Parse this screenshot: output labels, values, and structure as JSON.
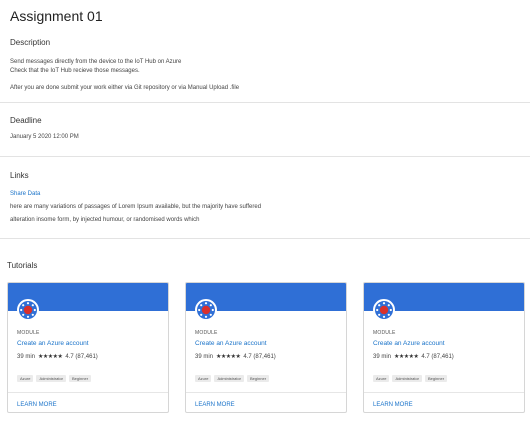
{
  "title": "Assignment 01",
  "description": {
    "heading": "Description",
    "lines": [
      "Send messages directly from the device to the IoT Hub on Azure",
      "Check that the IoT Hub recieve those messages.",
      "After you are done submit your work either via Git repository or via Manual Upload .file"
    ]
  },
  "deadline": {
    "heading": "Deadline",
    "value": "January 5 2020 12:00 PM"
  },
  "links": {
    "heading": "Links",
    "link_label": "Share Data",
    "lines": [
      "here are many variations of passages of Lorem Ipsum available, but the majority have suffered",
      "alteration insome form, by injected humour, or randomised words which"
    ]
  },
  "tutorials": {
    "heading": "Tutorials",
    "cards": [
      {
        "icon": "azure-module-icon",
        "type": "MODULE",
        "title": "Create an Azure account",
        "duration": "39 min",
        "stars": "★★★★★",
        "rating": "4.7 (87,461)",
        "tags": [
          "Azure",
          "Administrator",
          "Beginner"
        ],
        "cta": "LEARN MORE"
      },
      {
        "icon": "azure-module-icon",
        "type": "MODULE",
        "title": "Create an Azure account",
        "duration": "39 min",
        "stars": "★★★★★",
        "rating": "4.7 (87,461)",
        "tags": [
          "Azure",
          "Administrator",
          "Beginner"
        ],
        "cta": "LEARN MORE"
      },
      {
        "icon": "azure-module-icon",
        "type": "MODULE",
        "title": "Create an Azure account",
        "duration": "39 min",
        "stars": "★★★★★",
        "rating": "4.7 (87,461)",
        "tags": [
          "Azure",
          "Administrator",
          "Beginner"
        ],
        "cta": "LEARN MORE"
      }
    ]
  },
  "colors": {
    "accent": "#1a73c9",
    "banner": "#2f6fd6",
    "icon_center": "#d9302c"
  }
}
